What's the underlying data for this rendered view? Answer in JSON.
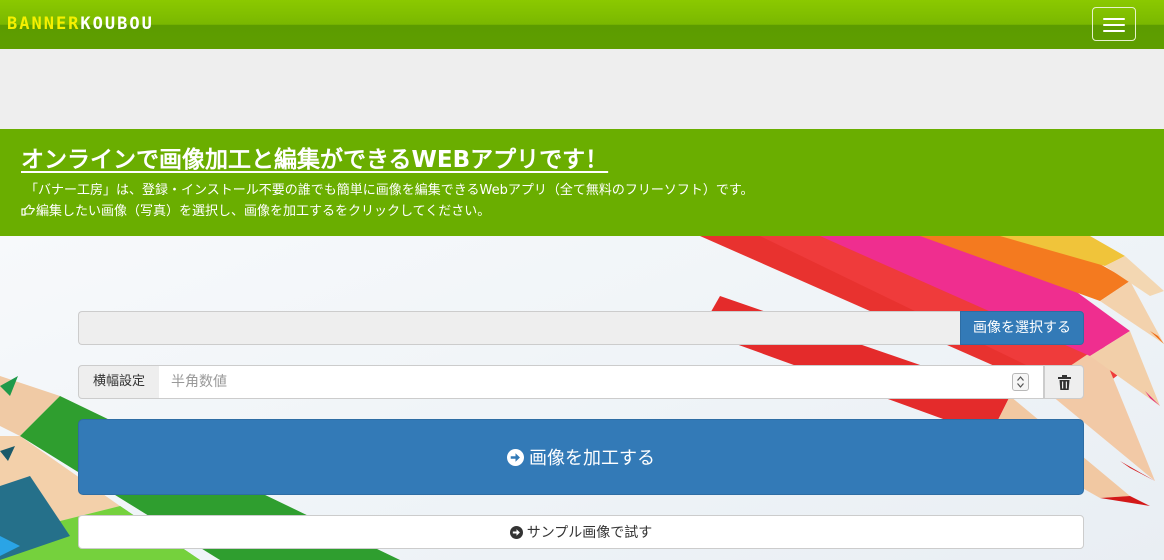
{
  "navbar": {
    "brand_part1": "BANNER",
    "brand_part2": "KOUBOU",
    "menu_icon": "hamburger-menu-icon",
    "brand_colors": {
      "part1": "#f5f000",
      "part2": "#ffffff",
      "bar": "#6aae00"
    }
  },
  "hero": {
    "title": "オンラインで画像加工と編集ができるWEBアプリです！",
    "description": "「バナー工房」は、登録・インストール不要の誰でも簡単に画像を編集できるWebアプリ（全て無料のフリーソフト）です。",
    "instruction": "編集したい画像（写真）を選択し、画像を加工するをクリックしてください。",
    "instruction_icon": "hand-point-right-icon"
  },
  "form": {
    "file_select_label": "画像を選択する",
    "width_label": "横幅設定",
    "width_placeholder": "半角数値",
    "clear_icon": "trash-icon",
    "process_label": "画像を加工する",
    "process_icon": "circle-arrow-right-icon",
    "sample_label": "サンプル画像で試す",
    "sample_icon": "circle-arrow-right-icon",
    "primary_color": "#337ab7"
  }
}
